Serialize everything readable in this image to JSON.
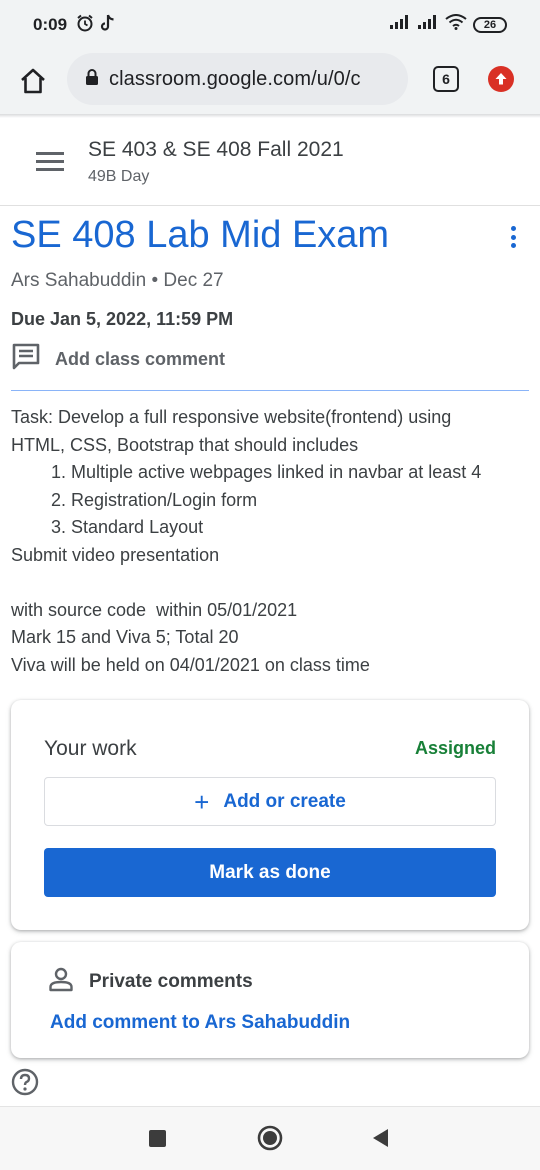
{
  "status_bar": {
    "time": "0:09",
    "left_icons": [
      "alarm-icon",
      "tiktok-icon"
    ],
    "right_icons": [
      "signal-icon",
      "signal-icon",
      "wifi-icon"
    ],
    "battery": "26"
  },
  "browser": {
    "url": "classroom.google.com/u/0/c",
    "tab_count": "6",
    "icons": [
      "home-icon",
      "lock-icon",
      "tab-switcher-icon",
      "update-icon"
    ]
  },
  "class_header": {
    "title": "SE 403 & SE 408 Fall 2021",
    "subtitle": "49B Day"
  },
  "assignment": {
    "title": "SE 408 Lab Mid Exam",
    "meta": "Ars Sahabuddin • Dec 27",
    "due": "Due Jan 5, 2022, 11:59 PM",
    "class_comment_label": "Add class comment",
    "description": {
      "line1": "Task: Develop a full responsive website(frontend) using",
      "line2": "HTML, CSS, Bootstrap that should includes",
      "items": [
        "1. Multiple active webpages linked in navbar at least 4",
        "2. Registration/Login form",
        "3. Standard Layout"
      ],
      "line3": "Submit video presentation",
      "line4": "with source code  within 05/01/2021",
      "line5": "Mark 15 and Viva 5; Total 20",
      "line6": "Viva will be held on 04/01/2021 on class time"
    }
  },
  "your_work": {
    "title": "Your work",
    "status": "Assigned",
    "status_color": "#188038",
    "add_create_label": "Add or create",
    "mark_done_label": "Mark as done"
  },
  "private_comments": {
    "title": "Private comments",
    "link": "Add comment to Ars Sahabuddin"
  },
  "colors": {
    "accent": "#1967d2",
    "text": "#3c4043",
    "muted": "#5f6368"
  }
}
